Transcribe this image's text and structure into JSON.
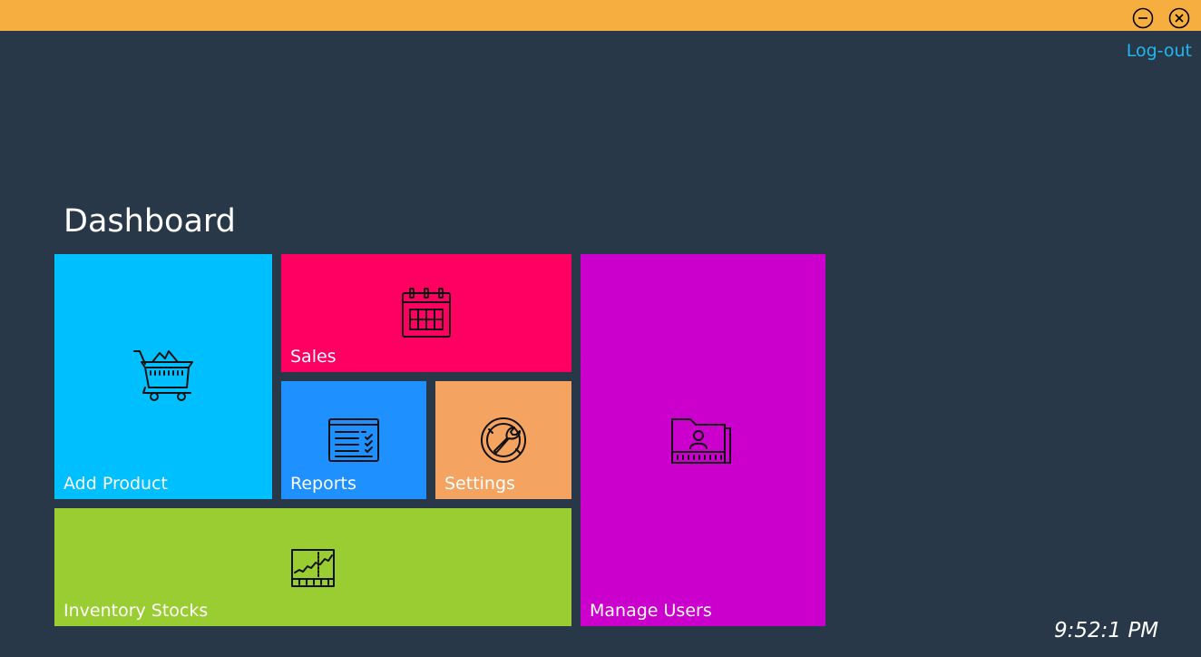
{
  "window": {
    "titlebar_color": "#f6ae40",
    "background_color": "#283849",
    "controls": [
      {
        "name": "minimize",
        "icon": "minus-circle-icon"
      },
      {
        "name": "close",
        "icon": "close-circle-icon"
      }
    ]
  },
  "header": {
    "logout_label": "Log-out",
    "logout_color": "#1fb8ec"
  },
  "page_title": "Dashboard",
  "tiles": {
    "add_product": {
      "label": "Add Product",
      "color": "#00bfff",
      "icon": "shopping-cart-icon"
    },
    "sales": {
      "label": "Sales",
      "color": "#ff0062",
      "icon": "calendar-icon"
    },
    "reports": {
      "label": "Reports",
      "color": "#1e90ff",
      "icon": "report-checklist-icon"
    },
    "settings": {
      "label": "Settings",
      "color": "#f4a460",
      "icon": "wrench-gear-icon"
    },
    "inventory_stocks": {
      "label": "Inventory Stocks",
      "color": "#9acd32",
      "icon": "stock-chart-icon"
    },
    "manage_users": {
      "label": "Manage Users",
      "color": "#cc00cc",
      "icon": "user-folder-icon"
    }
  },
  "clock": "9:52:1 PM"
}
